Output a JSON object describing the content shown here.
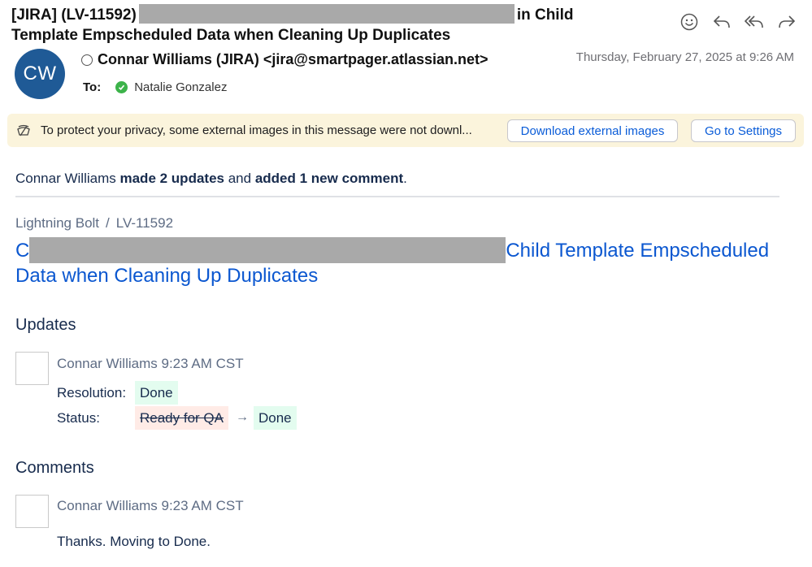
{
  "subject": {
    "part1": "[JIRA] (LV-11592)",
    "part2": "in Child",
    "line2": "Template Empscheduled Data when Cleaning Up Duplicates"
  },
  "actions": [
    {
      "name": "emoji-reaction",
      "icon": "smiley-icon"
    },
    {
      "name": "reply",
      "icon": "reply-icon"
    },
    {
      "name": "reply-all",
      "icon": "reply-all-icon"
    },
    {
      "name": "forward",
      "icon": "forward-icon"
    }
  ],
  "sender": {
    "initials": "CW",
    "display": "Connar Williams (JIRA) <jira@smartpager.atlassian.net>",
    "avatar_color": "#1f5a96"
  },
  "date": "Thursday, February 27, 2025 at 9:26 AM",
  "recipient": {
    "label": "To:",
    "name": "Natalie Gonzalez"
  },
  "privacy_banner": {
    "message": "To protect your privacy, some external images in this message were not downl...",
    "download_label": "Download external images",
    "settings_label": "Go to Settings"
  },
  "summary": {
    "actor": "Connar Williams",
    "updates": "made 2 updates",
    "mid": "and",
    "comments": "added 1 new comment",
    "end": "."
  },
  "breadcrumb": {
    "project": "Lightning Bolt",
    "separator": "/",
    "key": "LV-11592"
  },
  "issue_title": {
    "lead": "C",
    "visible": "Child Template Empscheduled",
    "line2": "Data when Cleaning Up Duplicates"
  },
  "updates": {
    "heading": "Updates",
    "author": "Connar Williams",
    "time": "9:23 AM CST",
    "resolution_label": "Resolution:",
    "resolution_value": "Done",
    "status_label": "Status:",
    "status_old": "Ready for QA",
    "status_arrow": "→",
    "status_new": "Done"
  },
  "comments": {
    "heading": "Comments",
    "author": "Connar Williams",
    "time": "9:23 AM CST",
    "text": "Thanks. Moving to Done."
  }
}
